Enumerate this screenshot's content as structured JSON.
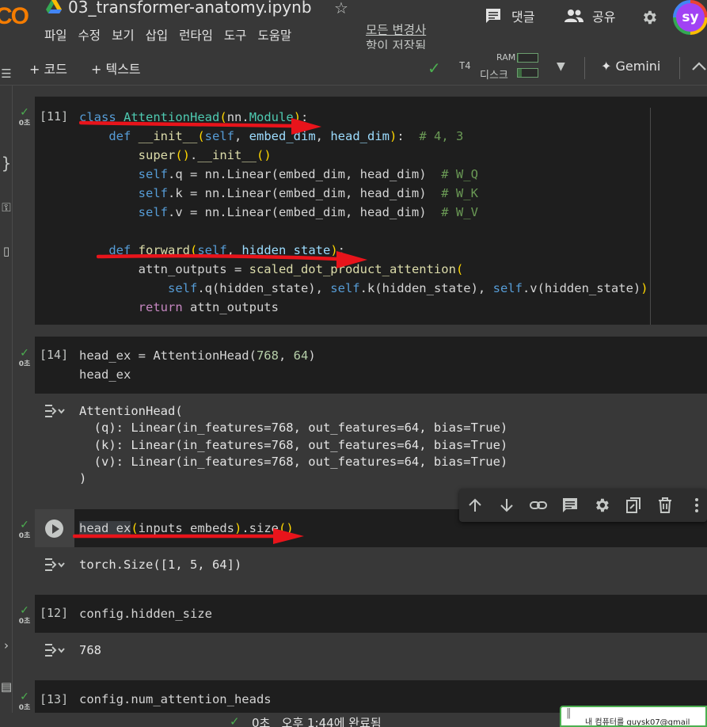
{
  "header": {
    "logo": "CO",
    "title": "03_transformer-anatomy.ipynb",
    "menu": [
      "파일",
      "수정",
      "보기",
      "삽입",
      "런타임",
      "도구",
      "도움말"
    ],
    "save_status_line1": "모든 변경사",
    "save_status_line2": "항이 저장됨",
    "comments_label": "댓글",
    "share_label": "공유",
    "avatar_initials": "sy"
  },
  "toolbar": {
    "add_code": "+ 코드",
    "add_text": "+ 텍스트",
    "runtime_type": "T4",
    "ram_label": "RAM",
    "disk_label": "디스크",
    "ram_usage_fraction": 0.05,
    "disk_usage_fraction": 0.2,
    "gemini_label": "Gemini"
  },
  "cells": {
    "c1": {
      "prompt": "[11]",
      "time": "0초",
      "lines": [
        "class AttentionHead(nn.Module):",
        "    def __init__(self, embed_dim, head_dim):  # 4, 3",
        "        super().__init__()",
        "        self.q = nn.Linear(embed_dim, head_dim)  # W_Q",
        "        self.k = nn.Linear(embed_dim, head_dim)  # W_K",
        "        self.v = nn.Linear(embed_dim, head_dim)  # W_V",
        "",
        "    def forward(self, hidden_state):",
        "        attn_outputs = scaled_dot_product_attention(",
        "            self.q(hidden_state), self.k(hidden_state), self.v(hidden_state))",
        "        return attn_outputs"
      ]
    },
    "c2": {
      "prompt": "[14]",
      "time": "0초",
      "lines": [
        "head_ex = AttentionHead(768, 64)",
        "head_ex"
      ],
      "output": [
        "AttentionHead(",
        "  (q): Linear(in_features=768, out_features=64, bias=True)",
        "  (k): Linear(in_features=768, out_features=64, bias=True)",
        "  (v): Linear(in_features=768, out_features=64, bias=True)",
        ")"
      ]
    },
    "c3": {
      "time": "0초",
      "line": "head_ex(inputs_embeds).size()",
      "output": "torch.Size([1, 5, 64])"
    },
    "c4": {
      "prompt": "[12]",
      "time": "0초",
      "line": "config.hidden_size",
      "output": "768"
    },
    "c5": {
      "prompt": "[13]",
      "time": "0초",
      "line": "config.num_attention_heads"
    }
  },
  "statusbar": {
    "check": "✓",
    "text": "0초   오후 1:44에 완료됨"
  },
  "toast": {
    "text": "내 컴퓨터를 guysk07@gmail"
  },
  "colors": {
    "background": "#383838",
    "code_bg": "#1e1e1e",
    "success": "#4caf50",
    "annotation_arrow": "#e8141b"
  }
}
